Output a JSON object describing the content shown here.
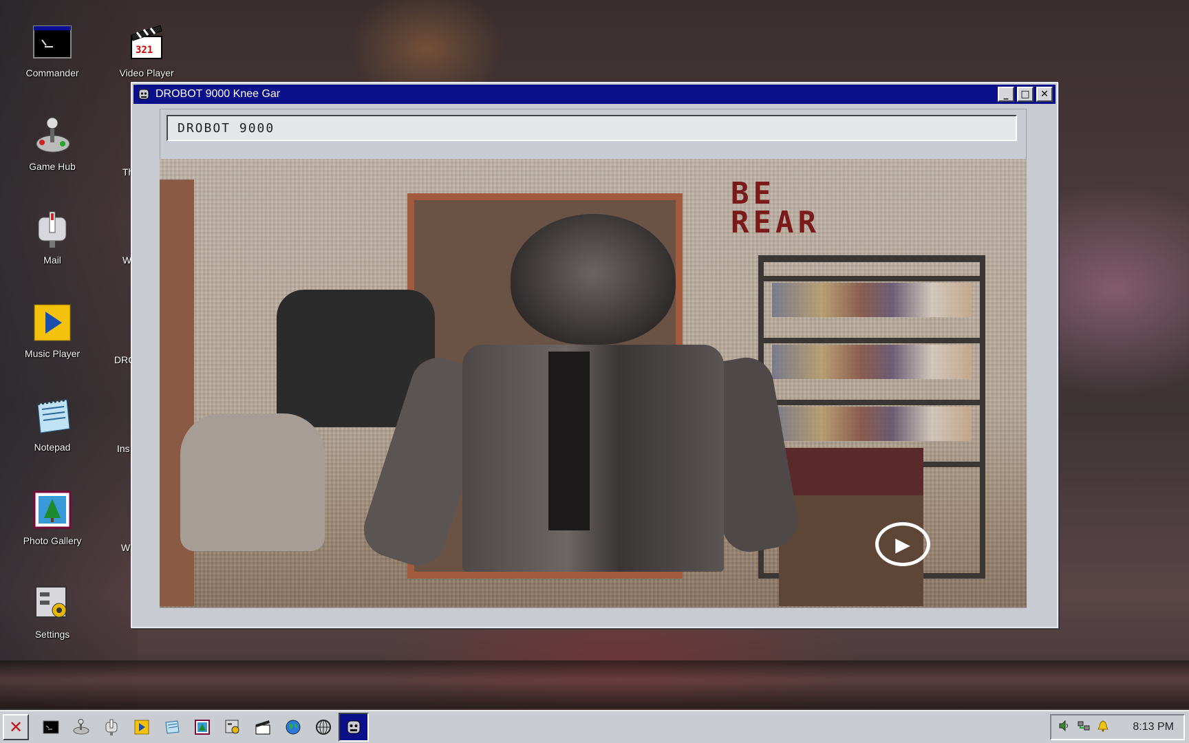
{
  "desktop": {
    "icons": [
      {
        "label": "Commander",
        "icon": "terminal-icon"
      },
      {
        "label": "Video Player",
        "icon": "clapperboard-icon"
      },
      {
        "label": "Game Hub",
        "icon": "joystick-icon"
      },
      {
        "label": "Mail",
        "icon": "mailbox-icon"
      },
      {
        "label": "Music Player",
        "icon": "play-icon"
      },
      {
        "label": "Notepad",
        "icon": "notepad-icon"
      },
      {
        "label": "Photo Gallery",
        "icon": "picture-icon"
      },
      {
        "label": "Settings",
        "icon": "control-panel-icon"
      }
    ],
    "partial_labels": [
      "Th",
      "W",
      "DRC",
      "Ins",
      "W"
    ]
  },
  "window": {
    "title": "DROBOT 9000 Knee Gar",
    "address_text": "DROBOT 9000",
    "controls": {
      "minimize": "_",
      "maximize": "□",
      "close": "✕"
    },
    "video": {
      "state": "paused",
      "play_icon": "▶",
      "scene_letters": "BE\nREAR"
    }
  },
  "taskbar": {
    "start_glyph": "✕",
    "apps": [
      "terminal-icon",
      "joystick-icon",
      "mailbox-icon",
      "music-player-icon",
      "notepad-icon",
      "photo-gallery-icon",
      "settings-icon",
      "video-player-icon",
      "globe-icon",
      "web-icon",
      "drobot-icon"
    ],
    "active_app": "drobot-icon",
    "tray": {
      "icons": [
        "volume-icon",
        "network-icon",
        "notification-bell-icon"
      ],
      "clock": "8:13 PM"
    }
  },
  "colors": {
    "titlebar": "#0a0f8a",
    "chrome": "#c8ccd2",
    "desktop_text": "#ffffff"
  }
}
